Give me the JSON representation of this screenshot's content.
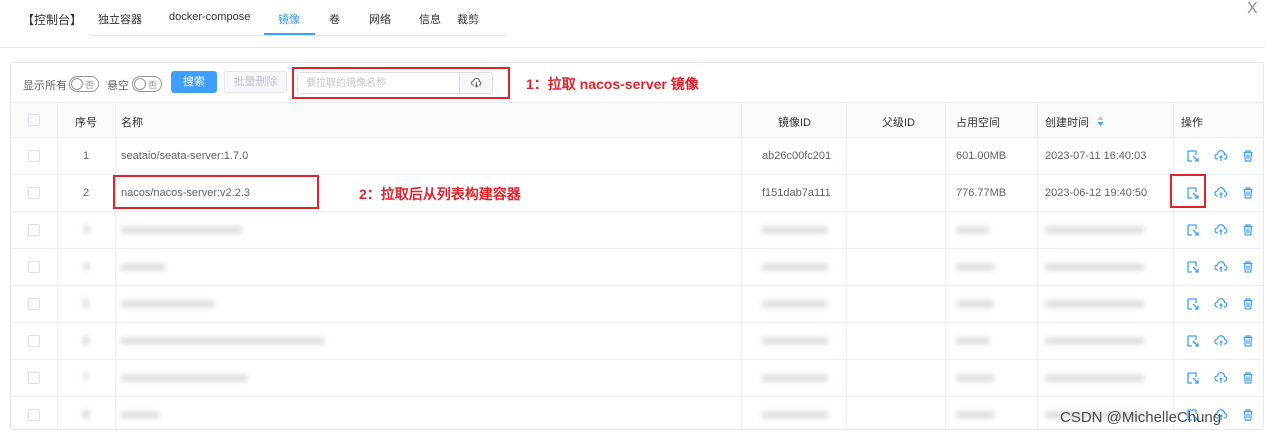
{
  "header": {
    "console_title": "【控制台】",
    "tabs": [
      {
        "label": "独立容器"
      },
      {
        "label": "docker-compose"
      },
      {
        "label": "镜像",
        "active": true
      },
      {
        "label": "卷"
      },
      {
        "label": "网络"
      },
      {
        "label": "信息"
      },
      {
        "label": "裁剪"
      }
    ],
    "close_glyph": "X"
  },
  "toolbar": {
    "show_all_label": "显示所有",
    "dangling_label": "悬空",
    "switch_off_text": "否",
    "search_button": "搜索",
    "batch_delete_button": "批量删除",
    "pull_input_placeholder": "要拉取的镜像名称",
    "pull_icon": "cloud-download-icon"
  },
  "annotations": {
    "step1": "1：拉取 nacos-server 镜像",
    "step2": "2：拉取后从列表构建容器"
  },
  "table": {
    "columns": [
      "序号",
      "名称",
      "镜像ID",
      "父级ID",
      "占用空间",
      "创建时间",
      "操作"
    ],
    "sort_icon": "sort-caret-icon",
    "rows": [
      {
        "index": "1",
        "name": "seataio/seata-server:1.7.0",
        "image_id": "ab26c00fc201",
        "parent_id": "",
        "size": "601.00MB",
        "created": "2023-07-11 16:40:03",
        "blurred": false
      },
      {
        "index": "2",
        "name": "nacos/nacos-server:v2.2.3",
        "image_id": "f151dab7a111",
        "parent_id": "",
        "size": "776.77MB",
        "created": "2023-06-12 19:40:50",
        "blurred": false
      },
      {
        "index": "3",
        "name": "xxxxxxxxxxxxxxxxxxxxxx",
        "image_id": "xxxxxxxxxxxx",
        "parent_id": "",
        "size": "xxxxxx",
        "created": "xxxxxxxxxxxxxxxxxx",
        "blurred": true
      },
      {
        "index": "4",
        "name": "xxxxxxxx",
        "image_id": "xxxxxxxxxxxx",
        "parent_id": "",
        "size": "xxxxxxx",
        "created": "xxxxxxxxxxxxxxxxxx",
        "blurred": true
      },
      {
        "index": "5",
        "name": "xxxxxxxxxxxxxxxxx",
        "image_id": "xxxxxxxxxxxx",
        "parent_id": "",
        "size": "xxxxxxx",
        "created": "xxxxxxxxxxxxxxxxxx",
        "blurred": true
      },
      {
        "index": "6",
        "name": "xxxxxxxxxxxxxxxxxxxxxxxxxxxxxxxxxxxxx",
        "image_id": "xxxxxxxxxxxx",
        "parent_id": "",
        "size": "xxxxxx",
        "created": "xxxxxxxxxxxxxxxxxx",
        "blurred": true
      },
      {
        "index": "7",
        "name": "xxxxxxxxxxxxxxxxxxxxxxx",
        "image_id": "xxxxxxxxxxxx",
        "parent_id": "",
        "size": "xxxxxxx",
        "created": "xxxxxxxxxxxxxxxxxx",
        "blurred": true
      },
      {
        "index": "8",
        "name": "xxxxxxx",
        "image_id": "xxxxxxxxxxxx",
        "parent_id": "",
        "size": "xxxxxxx",
        "created": "xxxxxxxxxxxxxxxxxx",
        "blurred": true
      }
    ],
    "actions": [
      "create-container-icon",
      "push-cloud-icon",
      "delete-icon"
    ]
  },
  "watermark": "CSDN @MichelleChung",
  "colors": {
    "accent": "#409eff",
    "annotation": "#e0242e"
  }
}
